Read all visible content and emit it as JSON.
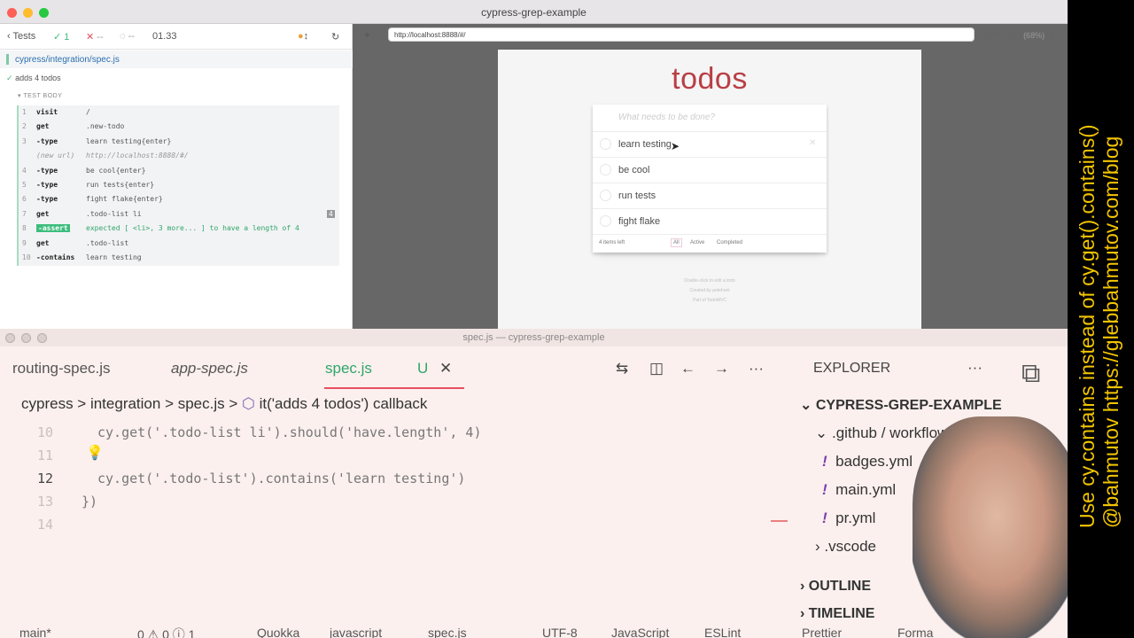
{
  "cypress": {
    "window_title": "cypress-grep-example",
    "tests_label": "Tests",
    "passed": "1",
    "failed": "--",
    "pending": "--",
    "duration": "01.33",
    "url": "http://localhost:8888/#/",
    "viewport": "1000 x 660",
    "zoom": "(68%)",
    "spec_path": "cypress/integration/spec.js",
    "test_title": "adds 4 todos",
    "section_label": "TEST BODY",
    "commands": [
      {
        "n": "1",
        "name": "visit",
        "msg": "/"
      },
      {
        "n": "2",
        "name": "get",
        "msg": ".new-todo"
      },
      {
        "n": "3",
        "name": "-type",
        "msg": "learn testing{enter}"
      },
      {
        "n": "",
        "name": "(new url)",
        "msg": "http://localhost:8888/#/"
      },
      {
        "n": "4",
        "name": "-type",
        "msg": "be cool{enter}"
      },
      {
        "n": "5",
        "name": "-type",
        "msg": "run tests{enter}"
      },
      {
        "n": "6",
        "name": "-type",
        "msg": "fight flake{enter}"
      },
      {
        "n": "7",
        "name": "get",
        "msg": ".todo-list li",
        "badge": "4"
      },
      {
        "n": "8",
        "name": "-assert",
        "msg": "expected [ <li>, 3 more... ] to have a length of 4"
      },
      {
        "n": "9",
        "name": "get",
        "msg": ".todo-list"
      },
      {
        "n": "10",
        "name": "-contains",
        "msg": "learn testing"
      }
    ]
  },
  "app": {
    "title": "todos",
    "placeholder": "What needs to be done?",
    "items": [
      "learn testing",
      "be cool",
      "run tests",
      "fight flake"
    ],
    "items_left": "4 items left",
    "filters": [
      "All",
      "Active",
      "Completed"
    ],
    "info": [
      "Double-click to edit a todo",
      "Created by petehunt",
      "Part of TodoMVC"
    ]
  },
  "vscode": {
    "window_title": "spec.js — cypress-grep-example",
    "tabs": [
      "routing-spec.js",
      "app-spec.js",
      "spec.js"
    ],
    "tab_status": "U",
    "breadcrumb": [
      "cypress",
      "integration",
      "spec.js",
      "it('adds 4 todos') callback"
    ],
    "lines": [
      {
        "n": "10",
        "code": "cy.get('.todo-list li').should('have.length', 4)"
      },
      {
        "n": "11",
        "code": ""
      },
      {
        "n": "12",
        "code": "cy.get('.todo-list').contains('learn testing')"
      },
      {
        "n": "13",
        "code": "})"
      },
      {
        "n": "14",
        "code": ""
      }
    ],
    "explorer_title": "EXPLORER",
    "project": "CYPRESS-GREP-EXAMPLE",
    "folder": ".github / workflows",
    "files": [
      "badges.yml",
      "main.yml",
      "pr.yml"
    ],
    "vscode_folder": ".vscode",
    "outline": "OUTLINE",
    "timeline": "TIMELINE",
    "status": [
      "main*",
      "0 ⚠ 0 ⓘ 1",
      "Quokka",
      "javascript",
      "spec.js",
      "UTF-8",
      "JavaScript",
      "ESLint",
      "Prettier",
      "Forma"
    ]
  },
  "banner": {
    "line1": "Use cy.contains instead of cy.get().contains()",
    "line2": "@bahmutov https://glebbahmutov.com/blog"
  },
  "colors": {
    "accent": "#b83f45",
    "banner": "#f3c500",
    "pass": "#3dbd7d",
    "fail": "#e94f5f"
  }
}
